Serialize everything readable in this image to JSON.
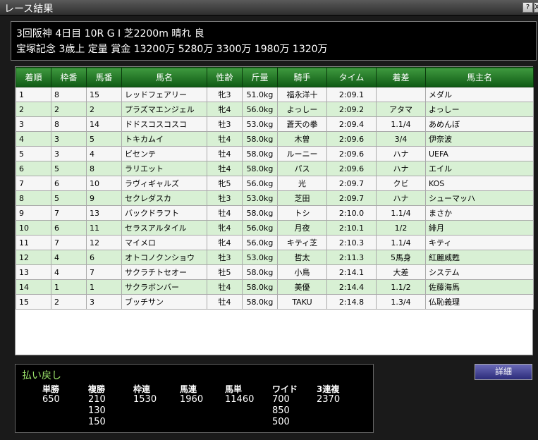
{
  "window": {
    "title": "レース結果",
    "help_label": "?",
    "close_label": "X"
  },
  "race": {
    "line1": "3回阪神  4日目  10R  G I  芝2200m  晴れ  良",
    "line2": "宝塚記念  3歳上  定量  賞金  13200万  5280万  3300万  1980万  1320万"
  },
  "table": {
    "headers": [
      "着順",
      "枠番",
      "馬番",
      "馬名",
      "性齢",
      "斤量",
      "騎手",
      "タイム",
      "着差",
      "馬主名"
    ],
    "rows": [
      [
        "1",
        "8",
        "15",
        "レッドフェアリー",
        "牝3",
        "51.0kg",
        "福永洋十",
        "2:09.1",
        "",
        "メダル"
      ],
      [
        "2",
        "2",
        "2",
        "プラズマエンジェル",
        "牝4",
        "56.0kg",
        "よっしー",
        "2:09.2",
        "アタマ",
        "よっしー"
      ],
      [
        "3",
        "8",
        "14",
        "ドドスコスコスコ",
        "牡3",
        "53.0kg",
        "蒼天の拳",
        "2:09.4",
        "1.1/4",
        "あめんぼ"
      ],
      [
        "4",
        "3",
        "5",
        "トキカムイ",
        "牡4",
        "58.0kg",
        "木曽",
        "2:09.6",
        "3/4",
        "伊奈波"
      ],
      [
        "5",
        "3",
        "4",
        "ビセンテ",
        "牡4",
        "58.0kg",
        "ルーニー",
        "2:09.6",
        "ハナ",
        "UEFA"
      ],
      [
        "6",
        "5",
        "8",
        "ラリエット",
        "牡4",
        "58.0kg",
        "パス",
        "2:09.6",
        "ハナ",
        "エイル"
      ],
      [
        "7",
        "6",
        "10",
        "ラヴィギャルズ",
        "牝5",
        "56.0kg",
        "光",
        "2:09.7",
        "クビ",
        "KOS"
      ],
      [
        "8",
        "5",
        "9",
        "セクレダスカ",
        "牡3",
        "53.0kg",
        "芝田",
        "2:09.7",
        "ハナ",
        "シューマッハ"
      ],
      [
        "9",
        "7",
        "13",
        "バックドラフト",
        "牡4",
        "58.0kg",
        "トシ",
        "2:10.0",
        "1.1/4",
        "まさか"
      ],
      [
        "10",
        "6",
        "11",
        "セラスアルタイル",
        "牝4",
        "56.0kg",
        "月夜",
        "2:10.1",
        "1/2",
        "緋月"
      ],
      [
        "11",
        "7",
        "12",
        "マイメロ",
        "牝4",
        "56.0kg",
        "キティ芝",
        "2:10.3",
        "1.1/4",
        "キティ"
      ],
      [
        "12",
        "4",
        "6",
        "オトコノクンショウ",
        "牡3",
        "53.0kg",
        "哲太",
        "2:11.3",
        "5馬身",
        "紅麗威甦"
      ],
      [
        "13",
        "4",
        "7",
        "サクラチトセオー",
        "牡5",
        "58.0kg",
        "小鳥",
        "2:14.1",
        "大差",
        "システム"
      ],
      [
        "14",
        "1",
        "1",
        "サクラボンバー",
        "牡4",
        "58.0kg",
        "美優",
        "2:14.4",
        "1.1/2",
        "佐藤海馬"
      ],
      [
        "15",
        "2",
        "3",
        "ブッチサン",
        "牡4",
        "58.0kg",
        "TAKU",
        "2:14.8",
        "1.3/4",
        "仏恥義理"
      ]
    ]
  },
  "payout": {
    "title": "払い戻し",
    "columns": [
      {
        "label": "単勝",
        "values": [
          "650"
        ]
      },
      {
        "label": "複勝",
        "values": [
          "210",
          "130",
          "150"
        ]
      },
      {
        "label": "枠連",
        "values": [
          "1530"
        ]
      },
      {
        "label": "馬連",
        "values": [
          "1960"
        ]
      },
      {
        "label": "馬単",
        "values": [
          "11460"
        ]
      },
      {
        "label": "ワイド",
        "values": [
          "700",
          "850",
          "500"
        ]
      },
      {
        "label": "3連複",
        "values": [
          "2370"
        ]
      }
    ]
  },
  "detail_button": "詳細"
}
